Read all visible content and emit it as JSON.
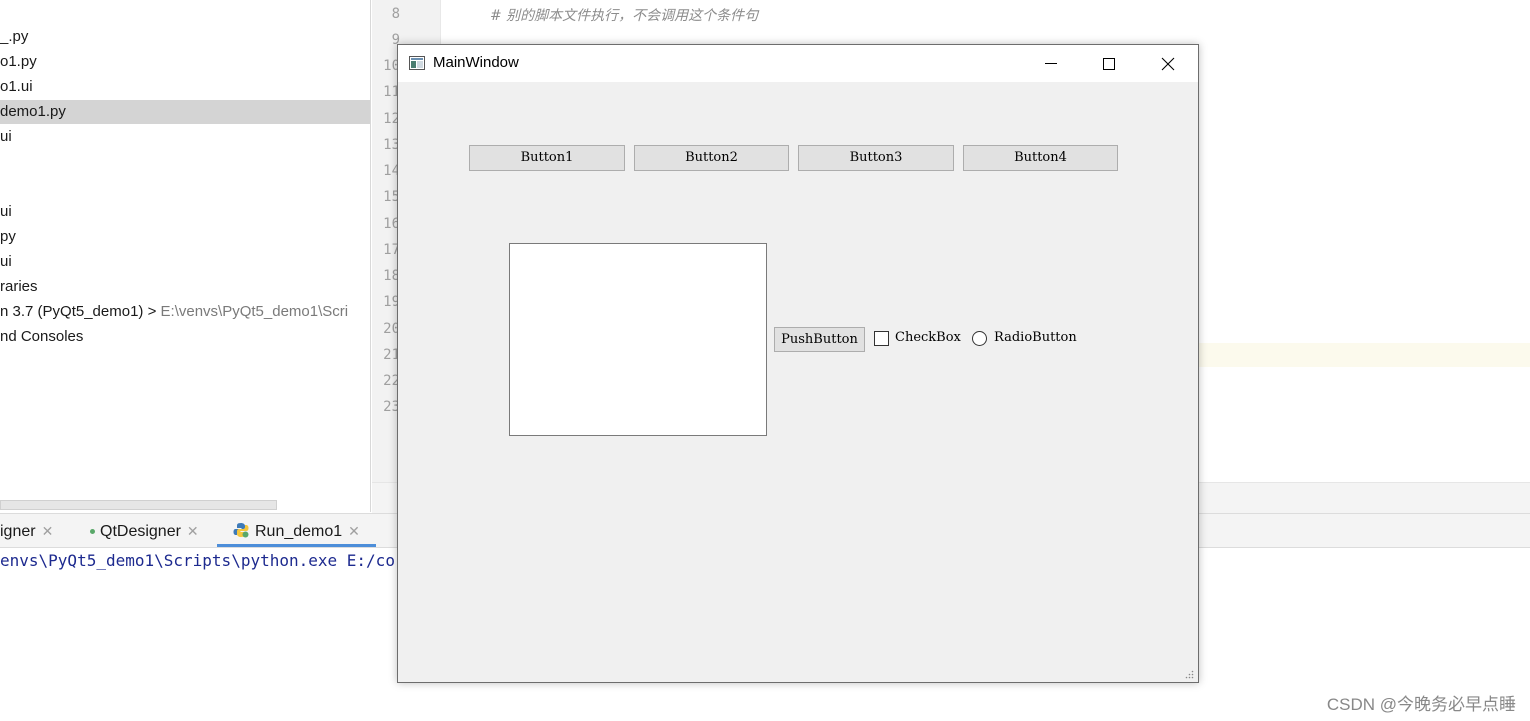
{
  "project_tree": {
    "items": [
      {
        "label": "_.py"
      },
      {
        "label": "o1.py"
      },
      {
        "label": "o1.ui"
      },
      {
        "label": "demo1.py"
      },
      {
        "label": "ui"
      },
      {
        "label": "ui"
      },
      {
        "label": "py"
      },
      {
        "label": "ui"
      },
      {
        "label": "raries"
      },
      {
        "label": "n 3.7 (PyQt5_demo1) >",
        "path": "E:\\venvs\\PyQt5_demo1\\Scri"
      },
      {
        "label": "nd Consoles"
      }
    ]
  },
  "editor": {
    "line_numbers": [
      "8",
      "9",
      "10",
      "11",
      "12",
      "13",
      "14",
      "15",
      "16",
      "17",
      "18",
      "19",
      "20",
      "21",
      "22",
      "23"
    ],
    "code_comment": "#  别的脚本文件执行，不会调用这个条件句"
  },
  "bottom_tabs": [
    {
      "label": "igner"
    },
    {
      "label": "QtDesigner"
    },
    {
      "label": "Run_demo1"
    }
  ],
  "console": {
    "line": "envs\\PyQt5_demo1\\Scripts\\python.exe E:/co"
  },
  "qt_window": {
    "title": "MainWindow",
    "buttons": [
      "Button1",
      "Button2",
      "Button3",
      "Button4"
    ],
    "push_button": "PushButton",
    "checkbox_label": "CheckBox",
    "radio_label": "RadioButton"
  },
  "watermark": "CSDN @今晚务必早点睡",
  "colors": {
    "accent": "#4d8ed9",
    "selection": "#d4d4d4",
    "console_text": "#1d2a8f"
  }
}
